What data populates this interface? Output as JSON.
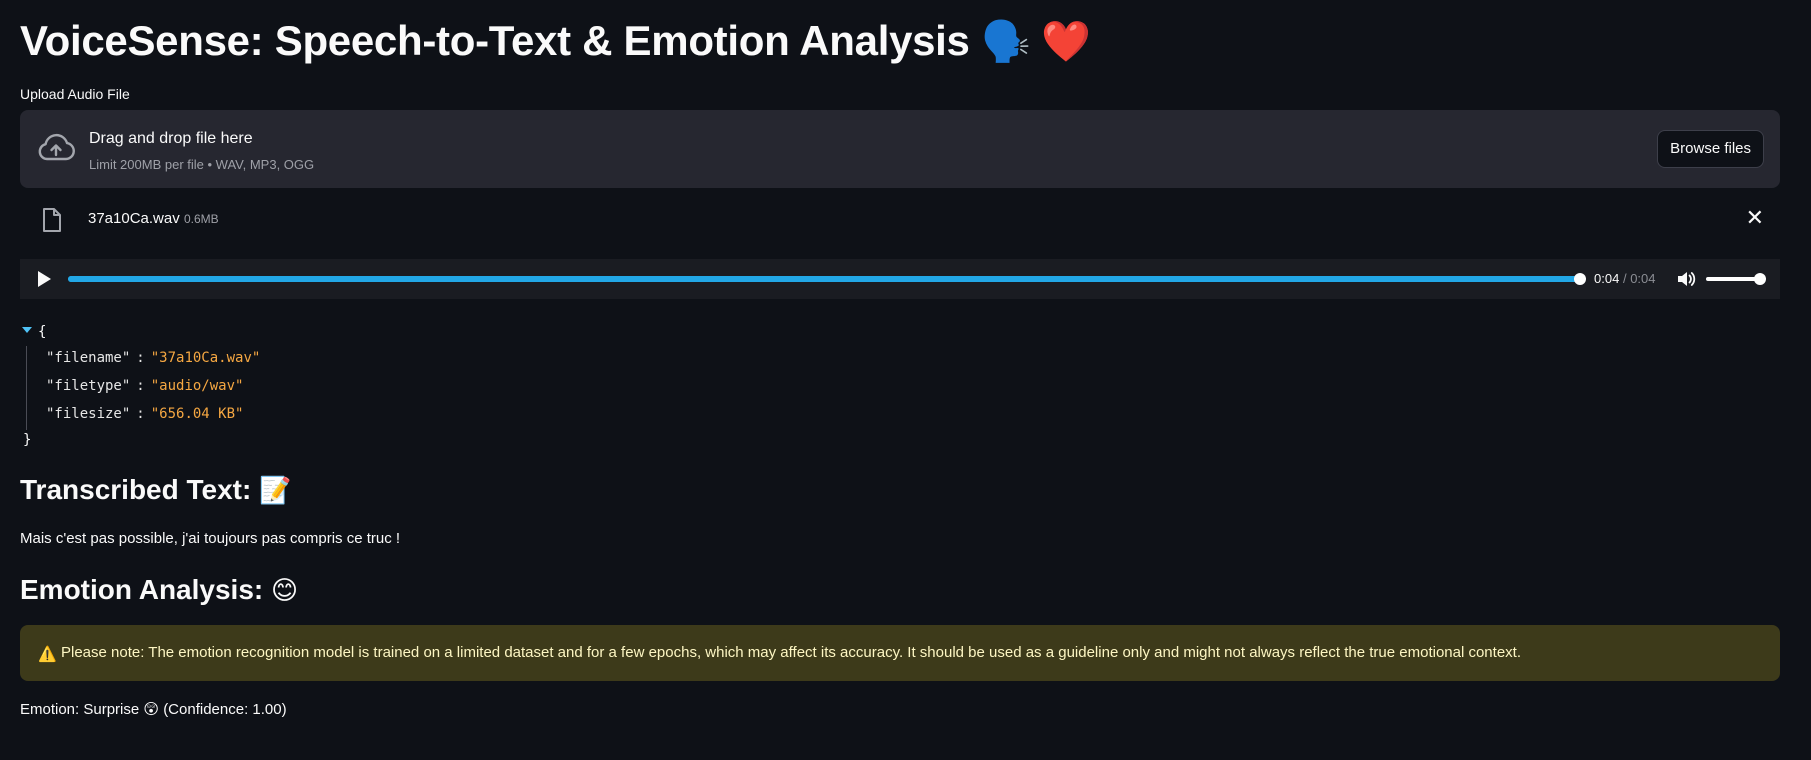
{
  "header": {
    "title": "VoiceSense: Speech-to-Text & Emotion Analysis",
    "title_emojis": "🗣️ ❤️"
  },
  "uploader": {
    "label": "Upload Audio File",
    "drop_text": "Drag and drop file here",
    "limit_text": "Limit 200MB per file • WAV, MP3, OGG",
    "browse_label": "Browse files",
    "icon": "cloud-upload-icon"
  },
  "uploaded_file": {
    "name": "37a10Ca.wav",
    "size": "0.6MB",
    "icon": "file-icon",
    "remove_icon": "close-icon"
  },
  "player": {
    "current_time": "0:04",
    "separator": "/",
    "duration": "0:04",
    "progress": 1.0,
    "volume": 1.0,
    "accent_color": "#1fa3e0"
  },
  "file_json": {
    "open_brace": "{",
    "close_brace": "}",
    "entries": [
      {
        "key": "\"filename\"",
        "value": "\"37a10Ca.wav\""
      },
      {
        "key": "\"filetype\"",
        "value": "\"audio/wav\""
      },
      {
        "key": "\"filesize\"",
        "value": "\"656.04 KB\""
      }
    ],
    "colon": ":"
  },
  "transcription": {
    "heading": "Transcribed Text:",
    "heading_emoji": "📝",
    "text": "Mais c'est pas possible, j'ai toujours pas compris ce truc !"
  },
  "emotion": {
    "heading": "Emotion Analysis:",
    "heading_emoji": "😊",
    "warning_icon": "⚠️",
    "warning_text": "Please note: The emotion recognition model is trained on a limited dataset and for a few epochs, which may affect its accuracy. It should be used as a guideline only and might not always reflect the true emotional context.",
    "result_text": "Emotion: Surprise 😲 (Confidence: 1.00)"
  },
  "colors": {
    "background": "#0e1117",
    "dropzone_bg": "#262730",
    "warning_bg": "#3d3a1a",
    "json_value": "#f5a742"
  }
}
